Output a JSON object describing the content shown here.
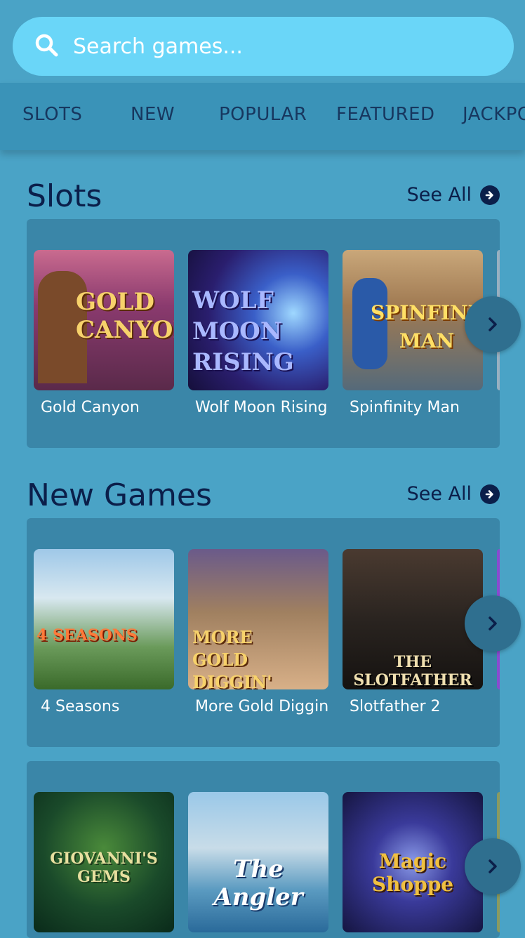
{
  "search": {
    "placeholder": "Search games..."
  },
  "tabs": [
    "SLOTS",
    "NEW",
    "POPULAR",
    "FEATURED",
    "JACKPO"
  ],
  "sections": [
    {
      "title": "Slots",
      "see_all": "See All",
      "games": [
        {
          "name": "Gold Canyon",
          "art": "GOLD CANYON"
        },
        {
          "name": "Wolf Moon Rising",
          "art": "WOLF MOON RISING"
        },
        {
          "name": "Spinfinity Man",
          "art": "SPINFINITY MAN"
        }
      ]
    },
    {
      "title": "New Games",
      "see_all": "See All",
      "games": [
        {
          "name": "4 Seasons",
          "art": "4 SEASONS"
        },
        {
          "name": "More Gold Diggin",
          "art": "MORE GOLD DIGGIN'"
        },
        {
          "name": "Slotfather 2",
          "art": "THE SLOTFATHER"
        }
      ]
    },
    {
      "games": [
        {
          "art": "GIOVANNI'S GEMS"
        },
        {
          "art": "The Angler"
        },
        {
          "art": "Magic Shoppe"
        }
      ]
    }
  ],
  "colors": {
    "background": "#4aa3c6",
    "search_bg": "#6ad6f8",
    "tab_bar": "#3a93b8",
    "panel": "#3a86a8",
    "heading": "#0b1f4a"
  }
}
